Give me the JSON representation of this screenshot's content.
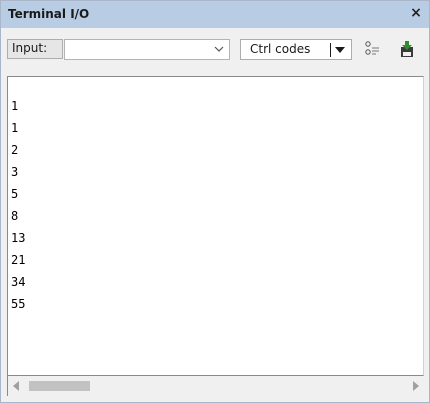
{
  "window": {
    "title": "Terminal I/O",
    "close_symbol": "×"
  },
  "toolbar": {
    "input_label": "Input:",
    "input_value": "",
    "ctrl_codes_label": "Ctrl codes",
    "icons": [
      "combo-dropdown-icon",
      "ctrl-codes-dropdown-icon",
      "options-icon",
      "log-to-file-icon"
    ]
  },
  "terminal": {
    "lines": [
      "1",
      "1",
      "2",
      "3",
      "5",
      "8",
      "13",
      "21",
      "34",
      "55"
    ]
  },
  "scrollbar": {
    "icons": [
      "scroll-left-icon",
      "scroll-right-icon"
    ]
  },
  "colors": {
    "titlebar": "#b8cde3",
    "window_bg": "#f0f0f0",
    "terminal_bg": "#ffffff",
    "scroll_thumb": "#c2c2c2",
    "save_icon_green": "#2e8b2e"
  }
}
